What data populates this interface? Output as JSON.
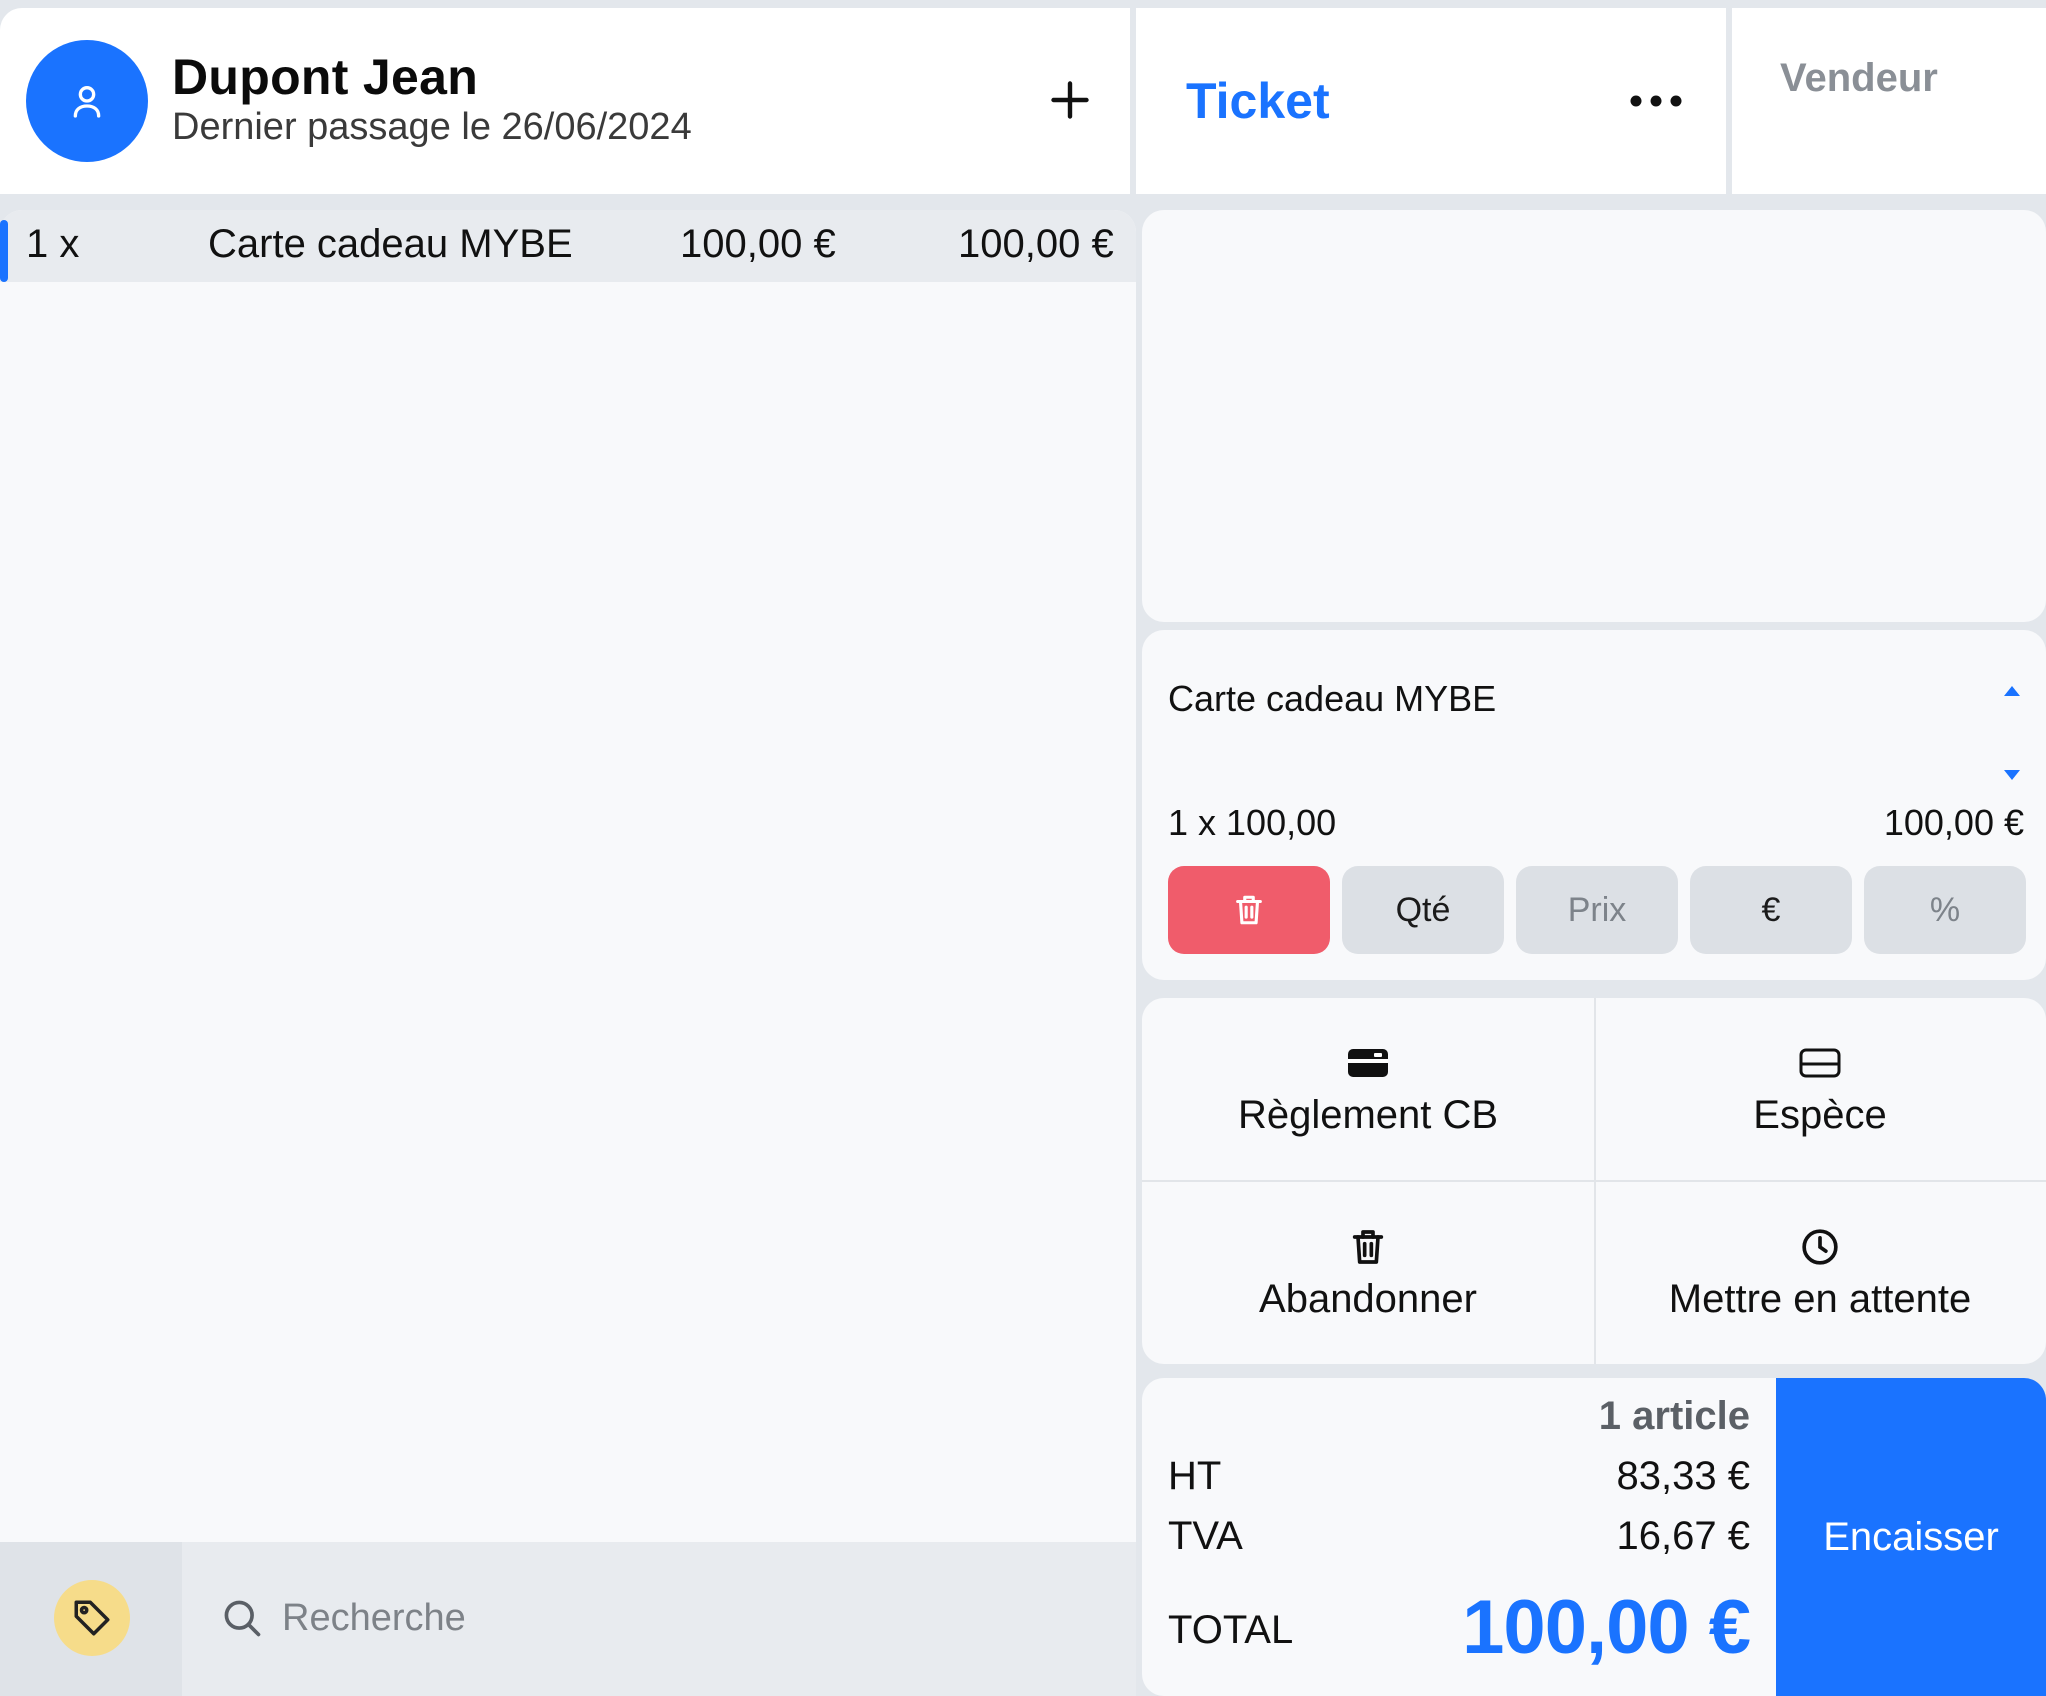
{
  "client": {
    "name": "Dupont Jean",
    "last_visit": "Dernier passage le 26/06/2024",
    "add_label": "+"
  },
  "ticket": {
    "title": "Ticket",
    "more_label": "•••"
  },
  "vendeur": {
    "label": "Vendeur"
  },
  "cart": {
    "lines": [
      {
        "qty": "1 x",
        "name": "Carte cadeau MYBE",
        "unit_price": "100,00 €",
        "total": "100,00 €"
      }
    ]
  },
  "search": {
    "placeholder": "Recherche"
  },
  "detail": {
    "name": "Carte cadeau MYBE",
    "qty_line": "1 x 100,00",
    "total": "100,00 €",
    "buttons": {
      "qte": "Qté",
      "prix": "Prix",
      "euro": "€",
      "percent": "%"
    }
  },
  "actions": {
    "reglement_cb": "Règlement CB",
    "espece": "Espèce",
    "abandonner": "Abandonner",
    "attente": "Mettre en attente"
  },
  "totals": {
    "articles": "1 article",
    "ht_label": "HT",
    "ht_value": "83,33 €",
    "tva_label": "TVA",
    "tva_value": "16,67 €",
    "total_label": "TOTAL",
    "total_value": "100,00 €",
    "encaisser": "Encaisser"
  },
  "colors": {
    "accent": "#1a73ff",
    "delete": "#f05c6b",
    "tag": "#f6dc8a"
  },
  "icons": {
    "avatar": "user-icon",
    "tag": "tag-icon",
    "search": "search-icon",
    "delete": "trash-icon",
    "cb": "card-icon",
    "cash": "cash-icon",
    "abandon": "trash-icon",
    "wait": "clock-icon"
  }
}
